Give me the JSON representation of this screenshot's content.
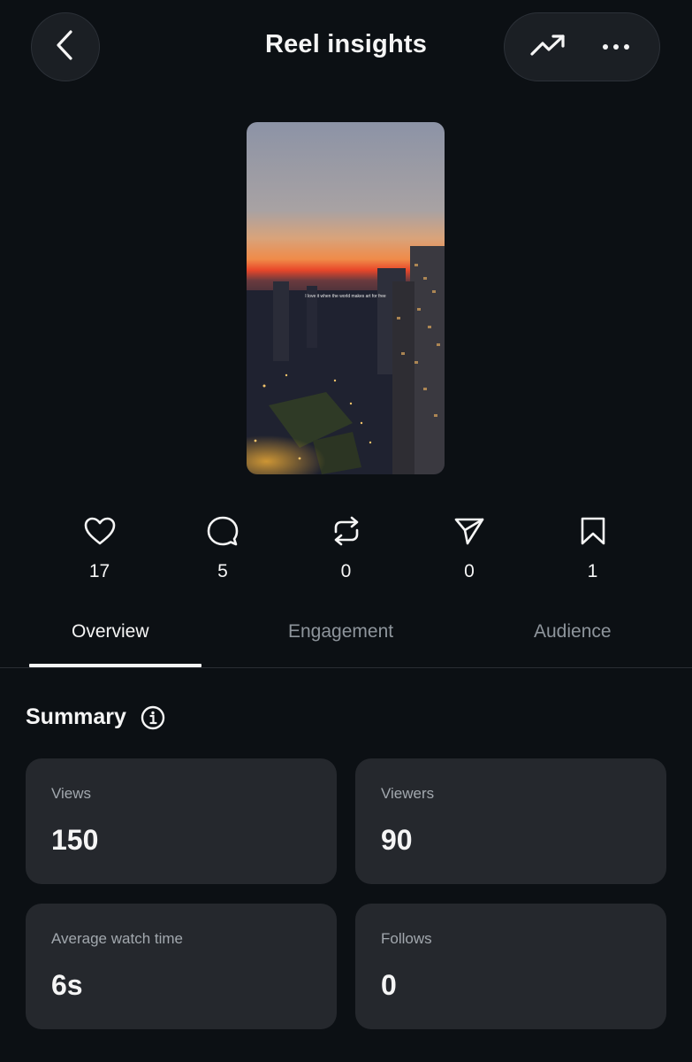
{
  "header": {
    "title": "Reel insights",
    "back_icon": "chevron-left-icon",
    "trend_icon": "trending-up-icon",
    "more_icon": "more-horizontal-icon"
  },
  "thumbnail": {
    "caption": "I love it when the world makes art for free"
  },
  "metrics": [
    {
      "icon": "heart-icon",
      "value": "17"
    },
    {
      "icon": "comment-icon",
      "value": "5"
    },
    {
      "icon": "repost-icon",
      "value": "0"
    },
    {
      "icon": "share-icon",
      "value": "0"
    },
    {
      "icon": "bookmark-icon",
      "value": "1"
    }
  ],
  "tabs": [
    {
      "label": "Overview",
      "active": true
    },
    {
      "label": "Engagement",
      "active": false
    },
    {
      "label": "Audience",
      "active": false
    }
  ],
  "summary": {
    "title": "Summary",
    "cards": [
      {
        "label": "Views",
        "value": "150"
      },
      {
        "label": "Viewers",
        "value": "90"
      },
      {
        "label": "Average watch time",
        "value": "6s"
      },
      {
        "label": "Follows",
        "value": "0"
      }
    ]
  },
  "colors": {
    "background": "#0c1014",
    "card": "#25282d",
    "text": "#f5f5f5",
    "muted": "#8e959c"
  }
}
